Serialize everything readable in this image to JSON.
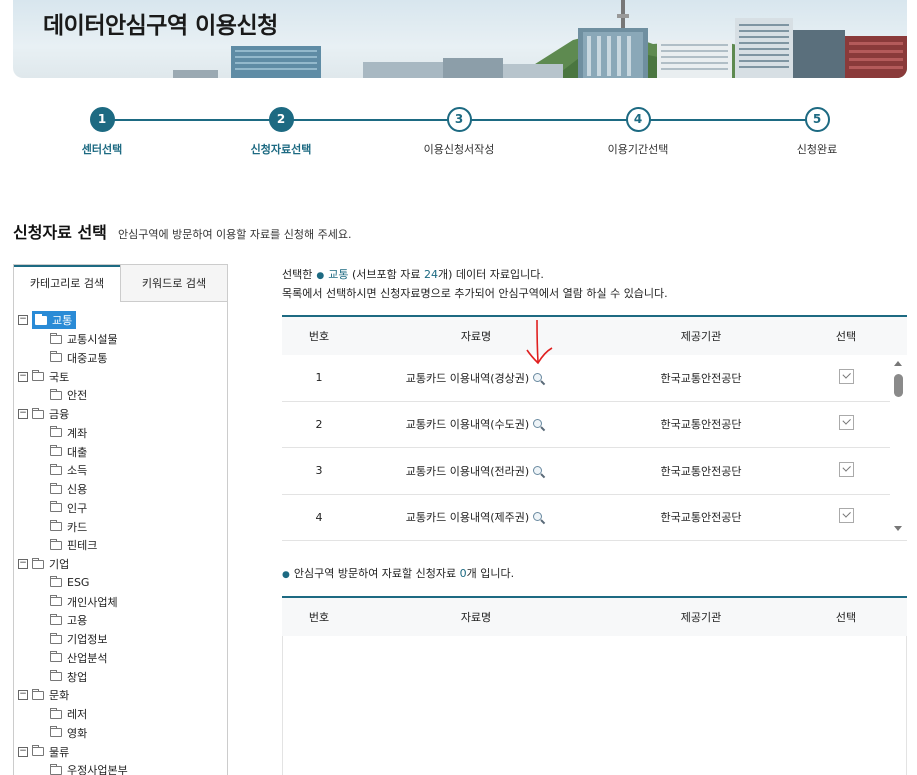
{
  "banner": {
    "title": "데이터안심구역 이용신청"
  },
  "stepper": {
    "steps": [
      {
        "num": "1",
        "label": "센터선택"
      },
      {
        "num": "2",
        "label": "신청자료선택"
      },
      {
        "num": "3",
        "label": "이용신청서작성"
      },
      {
        "num": "4",
        "label": "이용기간선택"
      },
      {
        "num": "5",
        "label": "신청완료"
      }
    ],
    "completed_steps": 2
  },
  "section": {
    "title": "신청자료 선택",
    "subtitle": "안심구역에 방문하여 이용할 자료를 신청해 주세요."
  },
  "left_tabs": {
    "category": "카테고리로 검색",
    "keyword": "키워드로 검색"
  },
  "tree": {
    "items": [
      {
        "label": "교통",
        "level": 0,
        "toggle": "−",
        "selected": true
      },
      {
        "label": "교통시설물",
        "level": 1
      },
      {
        "label": "대중교통",
        "level": 1
      },
      {
        "label": "국토",
        "level": 0,
        "toggle": "−"
      },
      {
        "label": "안전",
        "level": 1
      },
      {
        "label": "금융",
        "level": 0,
        "toggle": "−"
      },
      {
        "label": "계좌",
        "level": 1
      },
      {
        "label": "대출",
        "level": 1
      },
      {
        "label": "소득",
        "level": 1
      },
      {
        "label": "신용",
        "level": 1
      },
      {
        "label": "인구",
        "level": 1
      },
      {
        "label": "카드",
        "level": 1
      },
      {
        "label": "핀테크",
        "level": 1
      },
      {
        "label": "기업",
        "level": 0,
        "toggle": "−"
      },
      {
        "label": "ESG",
        "level": 1
      },
      {
        "label": "개인사업체",
        "level": 1
      },
      {
        "label": "고용",
        "level": 1
      },
      {
        "label": "기업정보",
        "level": 1
      },
      {
        "label": "산업분석",
        "level": 1
      },
      {
        "label": "창업",
        "level": 1
      },
      {
        "label": "문화",
        "level": 0,
        "toggle": "−"
      },
      {
        "label": "레저",
        "level": 1
      },
      {
        "label": "영화",
        "level": 1
      },
      {
        "label": "물류",
        "level": 0,
        "toggle": "−"
      },
      {
        "label": "우정사업본부",
        "level": 1
      }
    ]
  },
  "info": {
    "prefix": "선택한",
    "category": "교통",
    "mid1": "(서브포함 자료",
    "count": "24",
    "suffix": "개) 데이터 자료입니다.",
    "line2": "목록에서 선택하시면 신청자료명으로 추가되어 안심구역에서 열람 하실 수 있습니다."
  },
  "table": {
    "headers": {
      "num": "번호",
      "name": "자료명",
      "org": "제공기관",
      "select": "선택"
    },
    "rows": [
      {
        "num": "1",
        "name": "교통카드 이용내역(경상권)",
        "org": "한국교통안전공단"
      },
      {
        "num": "2",
        "name": "교통카드 이용내역(수도권)",
        "org": "한국교통안전공단"
      },
      {
        "num": "3",
        "name": "교통카드 이용내역(전라권)",
        "org": "한국교통안전공단"
      },
      {
        "num": "4",
        "name": "교통카드 이용내역(제주권)",
        "org": "한국교통안전공단"
      }
    ]
  },
  "selected_summary": {
    "prefix": "안심구역 방문하여 자료할 신청자료",
    "count": "0",
    "suffix": "개 입니다."
  },
  "colors": {
    "primary": "#1d6a82",
    "tree_selected": "#2a8bd6",
    "annotation": "#e02020"
  }
}
